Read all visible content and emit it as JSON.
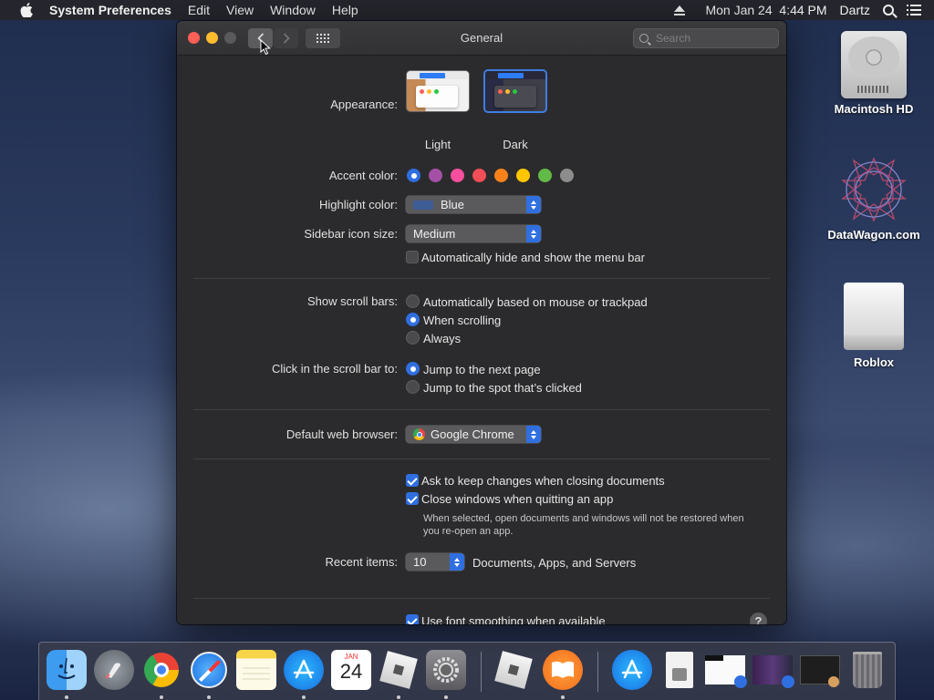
{
  "menubar": {
    "app_name": "System Preferences",
    "items": [
      "Edit",
      "View",
      "Window",
      "Help"
    ],
    "datetime": "Mon Jan 24  4:44 PM",
    "user": "Dartz"
  },
  "window": {
    "title": "General",
    "search_placeholder": "Search"
  },
  "appearance": {
    "label": "Appearance:",
    "options": [
      {
        "name": "Light",
        "selected": false
      },
      {
        "name": "Dark",
        "selected": true
      }
    ]
  },
  "accent": {
    "label": "Accent color:",
    "colors": [
      "#2f6fe0",
      "#a550a7",
      "#f74f9e",
      "#f24e58",
      "#f7821b",
      "#ffc600",
      "#62ba46",
      "#8c8c8c"
    ],
    "selected_index": 0
  },
  "highlight": {
    "label": "Highlight color:",
    "value": "Blue",
    "swatch": "#3e5d96"
  },
  "sidebar_icon": {
    "label": "Sidebar icon size:",
    "value": "Medium"
  },
  "menu_bar_autohide": {
    "label": "Automatically hide and show the menu bar",
    "checked": false
  },
  "scroll_bars": {
    "label": "Show scroll bars:",
    "options": [
      {
        "text": "Automatically based on mouse or trackpad",
        "selected": false
      },
      {
        "text": "When scrolling",
        "selected": true
      },
      {
        "text": "Always",
        "selected": false
      }
    ]
  },
  "scroll_click": {
    "label": "Click in the scroll bar to:",
    "options": [
      {
        "text": "Jump to the next page",
        "selected": true
      },
      {
        "text": "Jump to the spot that’s clicked",
        "selected": false
      }
    ]
  },
  "browser": {
    "label": "Default web browser:",
    "value": "Google Chrome"
  },
  "ask_keep": {
    "label": "Ask to keep changes when closing documents",
    "checked": true
  },
  "close_windows": {
    "label": "Close windows when quitting an app",
    "checked": true,
    "note": "When selected, open documents and windows will not be restored when you re-open an app."
  },
  "recent": {
    "label": "Recent items:",
    "value": "10",
    "suffix": "Documents, Apps, and Servers"
  },
  "font_smoothing": {
    "label": "Use font smoothing when available",
    "checked": true
  },
  "help_label": "?",
  "desktop": {
    "icons": [
      "Macintosh HD",
      "DataWagon.com",
      "Roblox"
    ]
  },
  "dock": {
    "calendar_month": "JAN",
    "calendar_day": "24",
    "apps": [
      "finder-icon",
      "launchpad-icon",
      "chrome-icon",
      "safari-icon",
      "notes-icon",
      "app-store-icon",
      "calendar-icon",
      "roblox-icon",
      "system-preferences-icon",
      "roblox-studio-icon",
      "books-icon",
      "app-store-folder-icon",
      "file-icon",
      "image-icon",
      "screenshot-icon",
      "window-icon",
      "trash-icon"
    ]
  }
}
